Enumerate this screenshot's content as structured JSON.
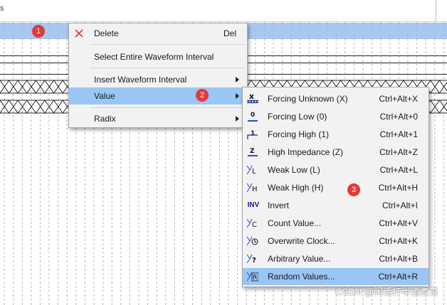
{
  "top_bar": {
    "letter": "s"
  },
  "context_menu": {
    "items": [
      {
        "label": "Delete",
        "shortcut": "Del",
        "icon": "delete-x-icon"
      },
      {
        "label": "Select Entire Waveform Interval",
        "shortcut": ""
      },
      {
        "label": "Insert Waveform Interval",
        "has_submenu": true
      },
      {
        "label": "Value",
        "has_submenu": true,
        "highlighted": true
      },
      {
        "label": "Radix",
        "has_submenu": true
      }
    ]
  },
  "value_submenu": {
    "items": [
      {
        "label": "Forcing Unknown (X)",
        "shortcut": "Ctrl+Alt+X",
        "icon": "forcing-unknown-icon"
      },
      {
        "label": "Forcing Low (0)",
        "shortcut": "Ctrl+Alt+0",
        "icon": "forcing-low-icon"
      },
      {
        "label": "Forcing High (1)",
        "shortcut": "Ctrl+Alt+1",
        "icon": "forcing-high-icon"
      },
      {
        "label": "High Impedance (Z)",
        "shortcut": "Ctrl+Alt+Z",
        "icon": "high-impedance-icon"
      },
      {
        "label": "Weak Low (L)",
        "shortcut": "Ctrl+Alt+L",
        "icon": "weak-low-icon"
      },
      {
        "label": "Weak High (H)",
        "shortcut": "Ctrl+Alt+H",
        "icon": "weak-high-icon"
      },
      {
        "label": "Invert",
        "shortcut": "Ctrl+Alt+I",
        "icon": "invert-icon",
        "icon_text": "INV"
      },
      {
        "label": "Count Value...",
        "shortcut": "Ctrl+Alt+V",
        "icon": "count-value-icon"
      },
      {
        "label": "Overwrite Clock...",
        "shortcut": "Ctrl+Alt+K",
        "icon": "overwrite-clock-icon"
      },
      {
        "label": "Arbitrary Value...",
        "shortcut": "Ctrl+Alt+B",
        "icon": "arbitrary-value-icon"
      },
      {
        "label": "Random Values...",
        "shortcut": "Ctrl+Alt+R",
        "icon": "random-values-icon",
        "highlighted": true
      }
    ]
  },
  "badges": [
    "1",
    "2",
    "3"
  ],
  "watermark": "CSDN @闲话杯半酒煮茶",
  "colors": {
    "selection": "#a9c8f0",
    "menu_highlight": "#9ac6f5",
    "badge": "#e43a3a",
    "menu_bg": "#f2f2f2"
  }
}
